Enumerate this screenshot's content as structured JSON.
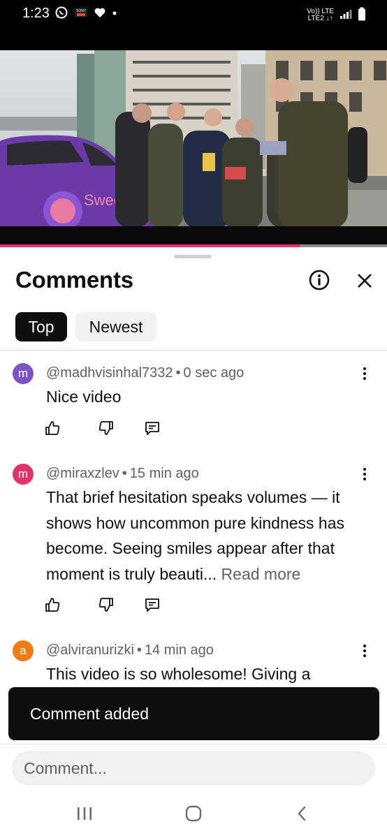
{
  "status_bar": {
    "time": "1:23",
    "network_top": "Vo)) LTE",
    "network_bottom": "LTE2 ↓↑"
  },
  "video": {
    "progress": 0.776,
    "car_brand_text": "Swee Flips"
  },
  "comments_panel": {
    "title": "Comments",
    "sort_chips": [
      {
        "label": "Top",
        "selected": true
      },
      {
        "label": "Newest",
        "selected": false
      }
    ],
    "comments": [
      {
        "avatar_letter": "m",
        "avatar_color": "#7c55c4",
        "author": "@madhvisinhal7332",
        "time": "0 sec ago",
        "text": "Nice video",
        "read_more": ""
      },
      {
        "avatar_letter": "m",
        "avatar_color": "#e3336b",
        "author": "@miraxzlev",
        "time": "15 min ago",
        "text": "That brief hesitation speaks volumes — it shows how uncommon pure kindness has become. Seeing smiles appear after that moment is truly beauti...",
        "read_more": "Read more"
      },
      {
        "avatar_letter": "a",
        "avatar_color": "#ef7b16",
        "author": "@alviranurizki",
        "time": "14 min ago",
        "text": "This video is so wholesome!  Giving a",
        "read_more": ""
      }
    ],
    "separator": "•"
  },
  "toast": {
    "message": "Comment added"
  },
  "composer": {
    "placeholder": "Comment..."
  },
  "colors": {
    "accent": "#ff2b6d",
    "text": "#0f0f0f",
    "secondary": "#606060"
  },
  "icons": [
    "whatsapp-icon",
    "sony-liv-icon",
    "heart-icon",
    "info-icon",
    "close-icon",
    "like-icon",
    "dislike-icon",
    "reply-icon",
    "more-icon",
    "recents-icon",
    "home-icon",
    "back-icon"
  ]
}
